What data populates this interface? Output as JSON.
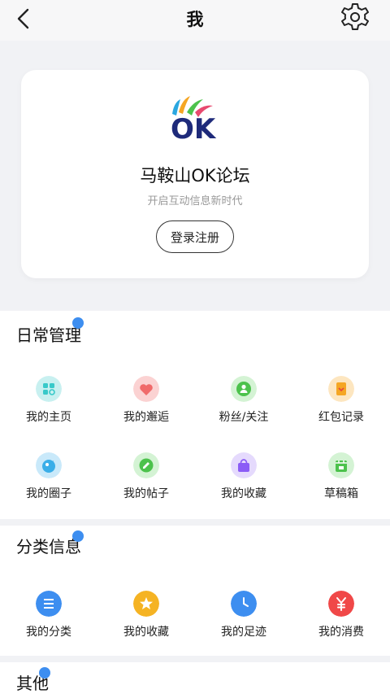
{
  "header": {
    "title": "我"
  },
  "profile": {
    "brand_name": "马鞍山OK论坛",
    "slogan": "开启互动信息新时代",
    "login_label": "登录注册",
    "logo_text": "OK"
  },
  "daily": {
    "title": "日常管理",
    "items": [
      {
        "label": "我的主页",
        "icon": "homepage-icon",
        "color": "#38c9c9"
      },
      {
        "label": "我的邂逅",
        "icon": "heart-icon",
        "color": "#f06a6a"
      },
      {
        "label": "粉丝/关注",
        "icon": "fans-icon",
        "color": "#4cc24c"
      },
      {
        "label": "红包记录",
        "icon": "red-packet-icon",
        "color": "#f5a623"
      },
      {
        "label": "我的圈子",
        "icon": "circle-icon",
        "color": "#3aaee8"
      },
      {
        "label": "我的帖子",
        "icon": "post-icon",
        "color": "#4cc24c"
      },
      {
        "label": "我的收藏",
        "icon": "bag-icon",
        "color": "#8b5cf6"
      },
      {
        "label": "草稿箱",
        "icon": "draft-icon",
        "color": "#4cc24c"
      }
    ]
  },
  "category": {
    "title": "分类信息",
    "items": [
      {
        "label": "我的分类",
        "icon": "list-icon",
        "color": "#3d8ef0"
      },
      {
        "label": "我的收藏",
        "icon": "star-icon",
        "color": "#f5b323"
      },
      {
        "label": "我的足迹",
        "icon": "clock-icon",
        "color": "#3d8ef0"
      },
      {
        "label": "我的消费",
        "icon": "yen-icon",
        "color": "#f04848"
      }
    ]
  },
  "other": {
    "title": "其他"
  }
}
